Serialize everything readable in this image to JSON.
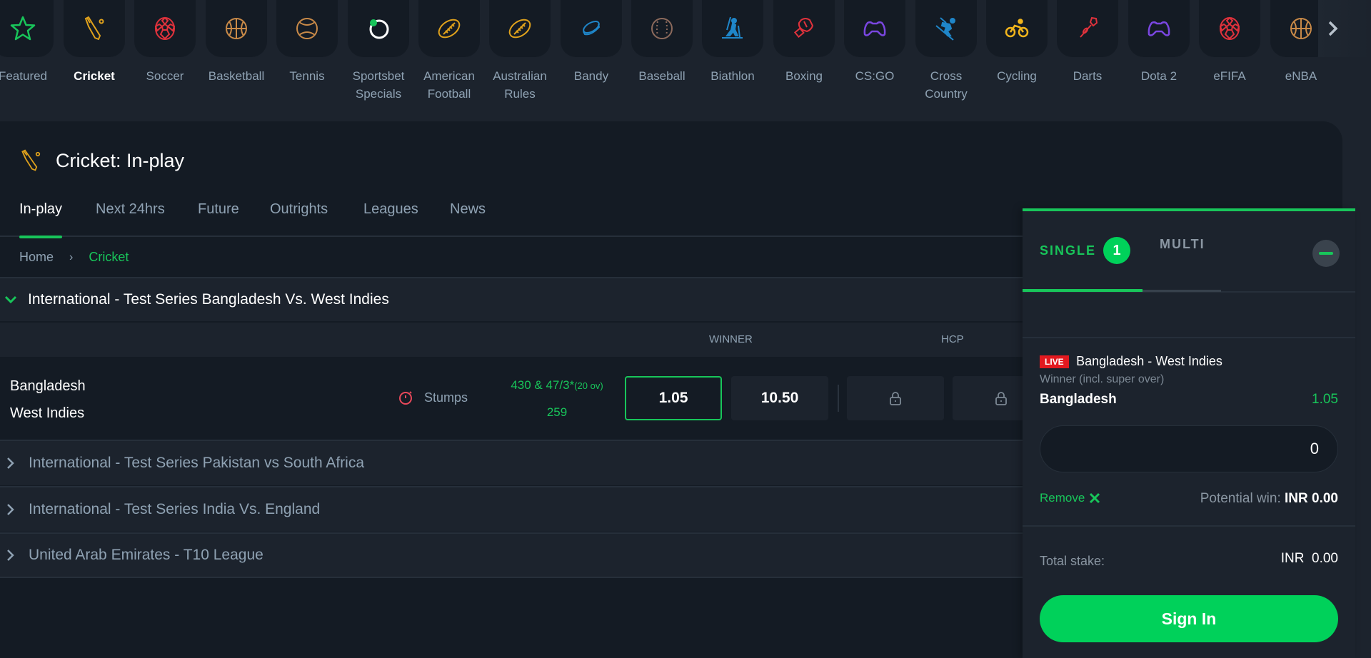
{
  "sports": [
    {
      "label": "Featured",
      "icon": "star-icon",
      "color": "#18c55a"
    },
    {
      "label": "Cricket",
      "icon": "cricket-icon",
      "color": "#e0a21c",
      "active": true
    },
    {
      "label": "Soccer",
      "icon": "soccer-icon",
      "color": "#e0323c"
    },
    {
      "label": "Basketball",
      "icon": "basketball-icon",
      "color": "#c98a48"
    },
    {
      "label": "Tennis",
      "icon": "tennis-icon",
      "color": "#c98a48"
    },
    {
      "label": "Sportsbet Specials",
      "icon": "specials-icon",
      "color": "#ffffff"
    },
    {
      "label": "American Football",
      "icon": "american-football-icon",
      "color": "#e0a21c"
    },
    {
      "label": "Australian Rules",
      "icon": "australian-rules-icon",
      "color": "#e0a21c"
    },
    {
      "label": "Bandy",
      "icon": "bandy-icon",
      "color": "#1f86c9"
    },
    {
      "label": "Baseball",
      "icon": "baseball-icon",
      "color": "#8c6a5c"
    },
    {
      "label": "Biathlon",
      "icon": "biathlon-icon",
      "color": "#1f86c9"
    },
    {
      "label": "Boxing",
      "icon": "boxing-icon",
      "color": "#e0323c"
    },
    {
      "label": "CS:GO",
      "icon": "gamepad-icon",
      "color": "#7a46e0"
    },
    {
      "label": "Cross Country",
      "icon": "cross-country-icon",
      "color": "#1f86c9"
    },
    {
      "label": "Cycling",
      "icon": "cycling-icon",
      "color": "#f2b51c"
    },
    {
      "label": "Darts",
      "icon": "darts-icon",
      "color": "#e0323c"
    },
    {
      "label": "Dota 2",
      "icon": "gamepad-icon",
      "color": "#7a46e0"
    },
    {
      "label": "eFIFA",
      "icon": "soccer-icon",
      "color": "#e0323c"
    },
    {
      "label": "eNBA",
      "icon": "basketball-icon",
      "color": "#c98a48"
    }
  ],
  "page": {
    "title": "Cricket: In-play",
    "tabs": [
      "In-play",
      "Next 24hrs",
      "Future",
      "Outrights",
      "Leagues",
      "News"
    ],
    "active_tab": "In-play",
    "breadcrumb": {
      "home": "Home",
      "current": "Cricket"
    }
  },
  "open_league": {
    "name": "International - Test Series Bangladesh Vs. West Indies",
    "market_headers": {
      "winner": "WINNER",
      "hcp": "HCP"
    },
    "match": {
      "team1": "Bangladesh",
      "team2": "West Indies",
      "status": "Stumps",
      "score1": "430 & 47/3*",
      "score1_overs": "(20 ov)",
      "score2": "259",
      "odds": [
        "1.05",
        "10.50"
      ],
      "selected_odd": "1.05"
    }
  },
  "leagues": [
    {
      "name": "International - Test Series Pakistan vs South Africa"
    },
    {
      "name": "International - Test Series India Vs. England"
    },
    {
      "name": "United Arab Emirates - T10 League"
    }
  ],
  "betslip": {
    "tab_single": "SINGLE",
    "single_count": "1",
    "tab_multi": "MULTI",
    "live_label": "LIVE",
    "event": "Bangladesh - West Indies",
    "market": "Winner (incl. super over)",
    "pick": "Bangladesh",
    "pick_odds": "1.05",
    "stake_value": "0",
    "remove_label": "Remove",
    "potential_label": "Potential win:",
    "potential_value": "INR 0.00",
    "total_label": "Total stake:",
    "total_value": "INR  0.00",
    "signin_label": "Sign In"
  },
  "colors": {
    "accent": "#18c55a",
    "live": "#e3191f",
    "background": "#141b24"
  }
}
